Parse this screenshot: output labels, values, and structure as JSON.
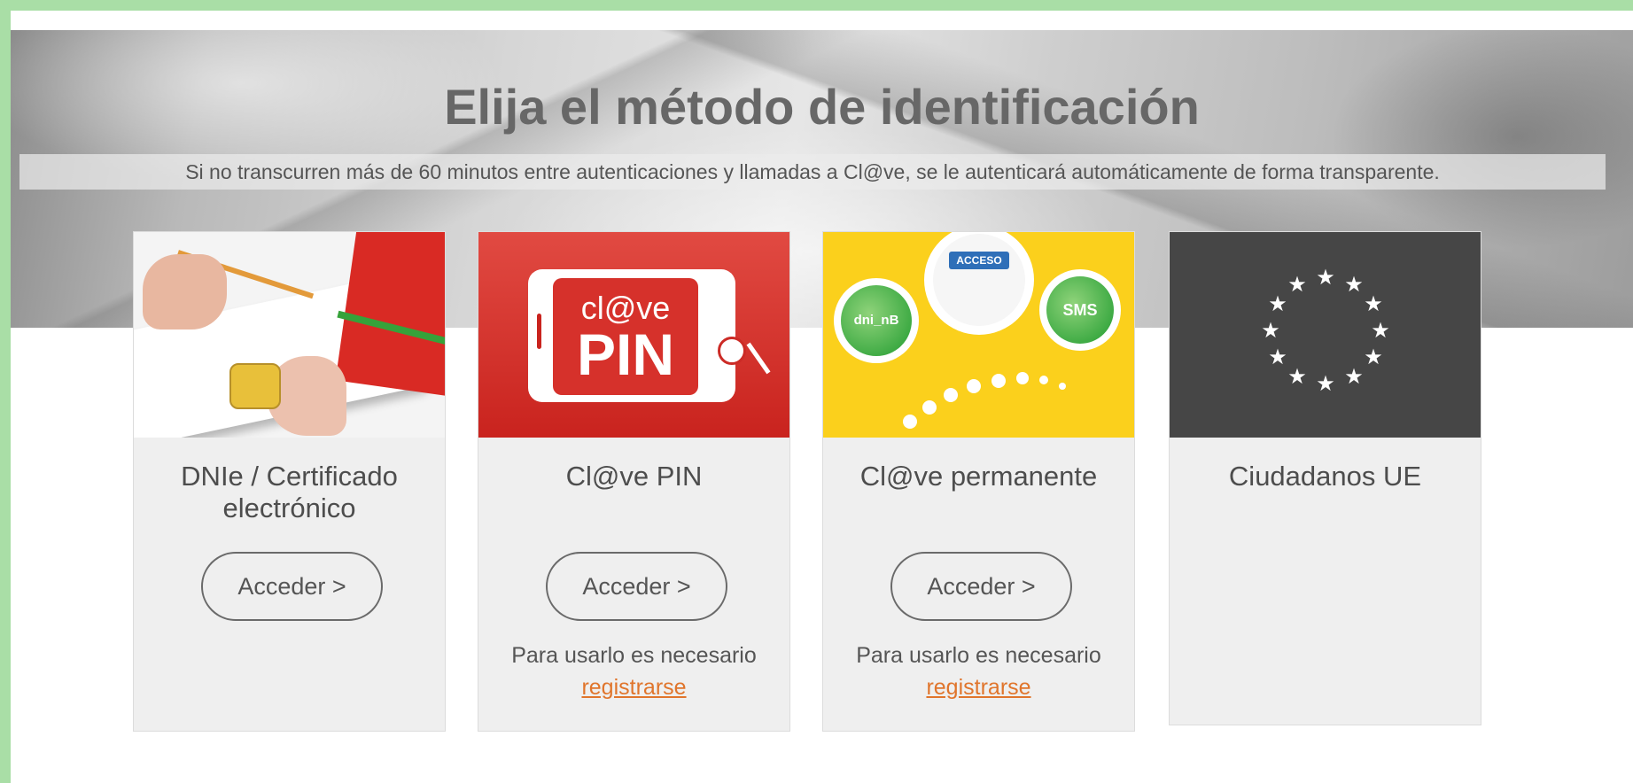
{
  "header": {
    "title": "Elija el método de identificación",
    "subtitle": "Si no transcurren más de 60 minutos entre autenticaciones y llamadas a Cl@ve, se le autenticará automáticamente de forma transparente."
  },
  "cards": [
    {
      "title": "DNIe / Certificado electrónico",
      "button_label": "Acceder  >"
    },
    {
      "title": "Cl@ve PIN",
      "image_text_top": "cl@ve",
      "image_text_bottom": "PIN",
      "button_label": "Acceder  >",
      "note": "Para usarlo es necesario",
      "link": "registrarse"
    },
    {
      "title": "Cl@ve permanente",
      "image_labels": {
        "left": "dni_nB",
        "top": "ACCESO",
        "right": "SMS"
      },
      "button_label": "Acceder  >",
      "note": "Para usarlo es necesario",
      "link": "registrarse"
    },
    {
      "title": "Ciudadanos UE"
    }
  ],
  "colors": {
    "frame": "#a9dea6",
    "link": "#e0752c",
    "eu_panel": "#464646",
    "pin_red": "#d6312b",
    "permanente_yellow": "#fbd01c"
  }
}
